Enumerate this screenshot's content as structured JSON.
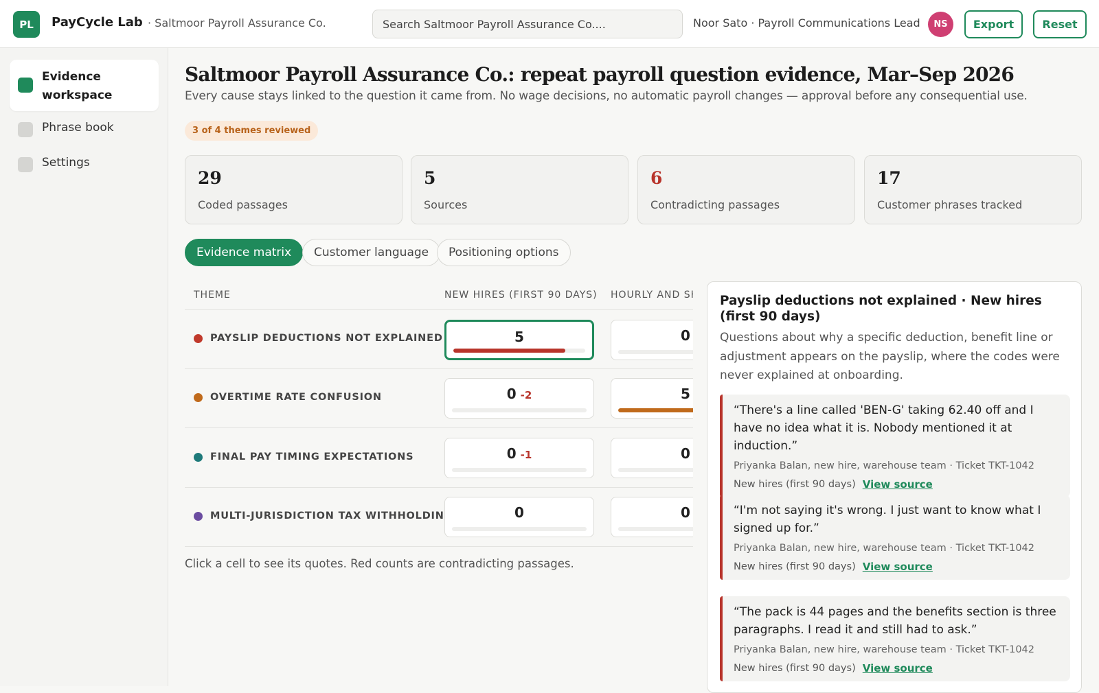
{
  "app": {
    "logo": "PL",
    "name": "PayCycle Lab",
    "org": "· Saltmoor Payroll Assurance Co.",
    "search_placeholder": "Search Saltmoor Payroll Assurance Co....",
    "user": "Noor Sato · Payroll Communications Lead",
    "avatar": "NS",
    "export_label": "Export",
    "reset_label": "Reset",
    "accent": "#1f8a5b"
  },
  "sidebar": {
    "items": [
      {
        "label": "Evidence workspace",
        "active": true
      },
      {
        "label": "Phrase book",
        "active": false
      },
      {
        "label": "Settings",
        "active": false
      }
    ]
  },
  "page": {
    "title": "Saltmoor Payroll Assurance Co.: repeat payroll question evidence, Mar–Sep 2026",
    "subtitle": "Every cause stays linked to the question it came from. No wage decisions, no automatic payroll changes — approval before any consequential use.",
    "badge": "3 of 4 themes reviewed"
  },
  "stats": [
    {
      "value": "29",
      "label": "Coded passages",
      "alert": false
    },
    {
      "value": "5",
      "label": "Sources",
      "alert": false
    },
    {
      "value": "6",
      "label": "Contradicting passages",
      "alert": true
    },
    {
      "value": "17",
      "label": "Customer phrases tracked",
      "alert": false
    }
  ],
  "tabs": [
    {
      "label": "Evidence matrix",
      "active": true
    },
    {
      "label": "Customer language",
      "active": false
    },
    {
      "label": "Positioning options",
      "active": false
    }
  ],
  "matrix": {
    "columns": [
      "THEME",
      "NEW HIRES (FIRST 90 DAYS)",
      "HOURLY AND SHIFT"
    ],
    "rows": [
      {
        "theme": "PAYSLIP DEDUCTIONS NOT EXPLAINED",
        "color": "#c0392b",
        "cells": [
          {
            "value": "5",
            "delta": "",
            "fill": 0.85,
            "fill_color": "#b8342b",
            "selected": true
          },
          {
            "value": "0",
            "delta": "",
            "fill": 0,
            "fill_color": "#b8342b",
            "selected": false
          }
        ]
      },
      {
        "theme": "OVERTIME RATE CONFUSION",
        "color": "#c06a1b",
        "cells": [
          {
            "value": "0",
            "delta": "-2",
            "fill": 0,
            "fill_color": "#c06a1b",
            "selected": false
          },
          {
            "value": "5",
            "delta": "",
            "fill": 0.85,
            "fill_color": "#c06a1b",
            "selected": false
          }
        ]
      },
      {
        "theme": "FINAL PAY TIMING EXPECTATIONS",
        "color": "#1f7a7a",
        "cells": [
          {
            "value": "0",
            "delta": "-1",
            "fill": 0,
            "fill_color": "#1f7a7a",
            "selected": false
          },
          {
            "value": "0",
            "delta": "",
            "fill": 0,
            "fill_color": "#1f7a7a",
            "selected": false
          }
        ]
      },
      {
        "theme": "MULTI-JURISDICTION TAX WITHHOLDING",
        "color": "#6b4ca0",
        "cells": [
          {
            "value": "0",
            "delta": "",
            "fill": 0,
            "fill_color": "#6b4ca0",
            "selected": false
          },
          {
            "value": "0",
            "delta": "",
            "fill": 0,
            "fill_color": "#6b4ca0",
            "selected": false
          }
        ]
      }
    ],
    "hint": "Click a cell to see its quotes. Red counts are contradicting passages."
  },
  "detail": {
    "title": "Payslip deductions not explained · New hires (first 90 days)",
    "description": "Questions about why a specific deduction, benefit line or adjustment appears on the payslip, where the codes were never explained at onboarding.",
    "quotes": [
      {
        "text": "“There's a line called 'BEN-G' taking 62.40 off and I have no idea what it is. Nobody mentioned it at induction.”",
        "meta": "Priyanka Balan, new hire, warehouse team · Ticket TKT-1042",
        "segment": "New hires (first 90 days)",
        "link": "View source"
      },
      {
        "text": "“I'm not saying it's wrong. I just want to know what I signed up for.”",
        "meta": "Priyanka Balan, new hire, warehouse team · Ticket TKT-1042",
        "segment": "New hires (first 90 days)",
        "link": "View source"
      },
      {
        "text": "“The pack is 44 pages and the benefits section is three paragraphs. I read it and still had to ask.”",
        "meta": "Priyanka Balan, new hire, warehouse team · Ticket TKT-1042",
        "segment": "New hires (first 90 days)",
        "link": "View source"
      }
    ]
  }
}
